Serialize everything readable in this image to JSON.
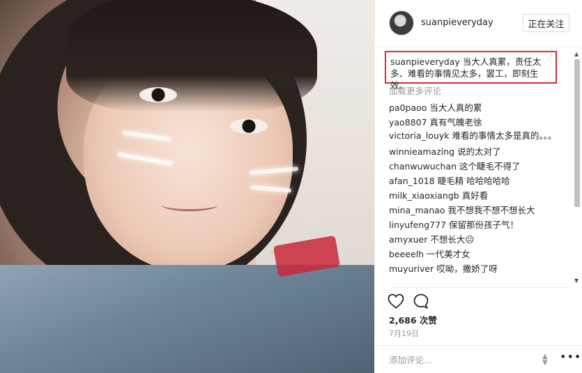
{
  "post": {
    "author": "suanpieveryday",
    "follow_label": "正在关注",
    "caption_user": "suanpieveryday",
    "caption_text": " 当大人真累，责任太多、难看的事情见太多，罢工，即刻生效。",
    "load_more": "加载更多评论",
    "likes": "2,686 次赞",
    "date": "7月19日"
  },
  "comments": [
    {
      "user": "pa0paoo",
      "text": "当大人真的累"
    },
    {
      "user": "yao8807",
      "text": "真有气魄老徐"
    },
    {
      "user": "victoria_louyk",
      "text": "难看的事情太多是真的。。。"
    },
    {
      "user": "winnieamazing",
      "text": "说的太对了"
    },
    {
      "user": "chanwuwuchan",
      "text": "这个睫毛不得了"
    },
    {
      "user": "afan_1018",
      "text": "睫毛精 哈哈哈哈哈"
    },
    {
      "user": "milk_xiaoxiangb",
      "text": "真好看"
    },
    {
      "user": "mina_manao",
      "text": "我不想我不想不想长大"
    },
    {
      "user": "linyufeng777",
      "text": "保留那份孩子气！"
    },
    {
      "user": "amyxuer",
      "text": "不想长大☹"
    },
    {
      "user": "beeeelh",
      "text": "一代美才女"
    },
    {
      "user": "muyuriver",
      "text": "哎呦，撒娇了呀"
    }
  ],
  "comment_box": {
    "placeholder": "添加评论..."
  },
  "icons": {
    "like": "heart-icon",
    "comment": "comment-icon",
    "more": "more-options-icon"
  }
}
